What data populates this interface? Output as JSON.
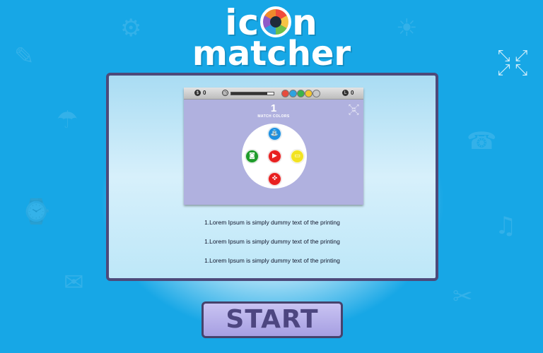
{
  "logo": {
    "line1_left": "ic",
    "line1_right": "n",
    "line2": "matcher"
  },
  "icons": {
    "fullscreen": "fullscreen-icon",
    "score": "score-icon",
    "timer": "stopwatch-icon",
    "level": "level-icon",
    "wheel_icons": [
      "water-tap-icon",
      "camera-icon",
      "movie-camera-icon",
      "gamepad-icon",
      "message-icon"
    ]
  },
  "preview": {
    "score_value": "0",
    "level_value": "0",
    "timer_progress": 0.85,
    "level_number": "1",
    "subtitle": "MATCH COLORS",
    "swatch_colors": [
      "#e74c3c",
      "#2ea3e0",
      "#3bb44a",
      "#f3c531",
      "#c8c8c8"
    ],
    "dot_colors": {
      "top": "#1e90e0",
      "left": "#1e9b2a",
      "center": "#e82020",
      "right": "#f2e321",
      "bottom": "#e82020"
    }
  },
  "instructions": [
    "1.Lorem Ipsum is simply dummy text of the printing",
    "1.Lorem Ipsum is simply dummy text of the printing",
    "1.Lorem Ipsum is simply dummy text of the printing"
  ],
  "start_label": "START"
}
